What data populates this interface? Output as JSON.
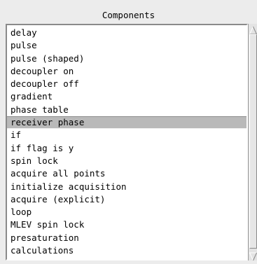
{
  "panel": {
    "title": "Components"
  },
  "list": {
    "items": [
      "delay",
      "pulse",
      "pulse (shaped)",
      "decoupler on",
      "decoupler off",
      "gradient",
      "phase table",
      "receiver phase",
      "if",
      "if flag is y",
      "spin lock",
      "acquire all points",
      "initialize acquisition",
      "acquire (explicit)",
      "loop",
      "MLEV spin lock",
      "presaturation",
      "calculations"
    ],
    "selected_item": "receiver phase"
  },
  "scrollbar": {
    "up_icon": "triangle-up-icon",
    "down_icon": "triangle-down-icon"
  }
}
